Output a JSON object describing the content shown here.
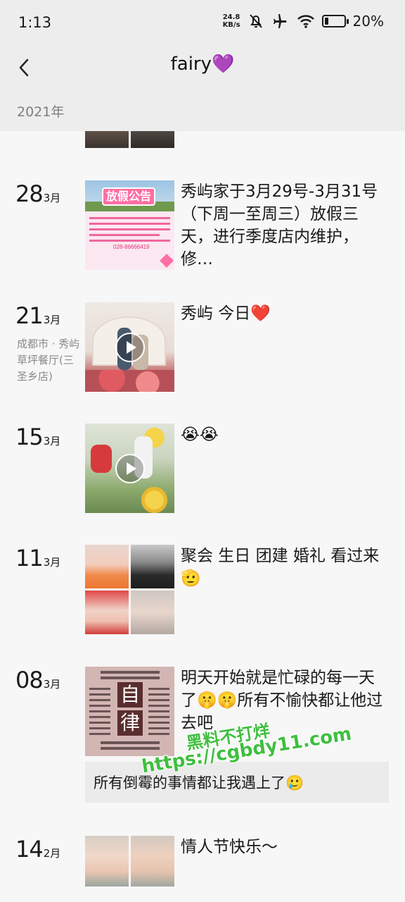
{
  "status_bar": {
    "time": "1:13",
    "net_speed_value": "24.8",
    "net_speed_unit": "KB/s",
    "battery_percent": "20%",
    "battery_level": 0.2
  },
  "nav": {
    "title": "fairy",
    "title_emoji": "💜"
  },
  "year": "2021年",
  "entries": [
    {
      "day": "28",
      "month": "3月",
      "text": "秀屿家于3月29号-3月31号（下周一至周三）放假三天，进行季度店内维护，修…",
      "poster_title": "放假公告",
      "poster_phone": "028-86666419"
    },
    {
      "day": "21",
      "month": "3月",
      "location": "成都市 · 秀屿草坪餐厅(三圣乡店)",
      "text": "秀屿 今日",
      "emoji": "❤️"
    },
    {
      "day": "15",
      "month": "3月",
      "text": "",
      "emoji": "😭😭"
    },
    {
      "day": "11",
      "month": "3月",
      "text": "聚会 生日 团建 婚礼 看过来",
      "emoji": "🫡"
    },
    {
      "day": "08",
      "month": "3月",
      "text_a": "明天开始就是忙碌的每一天了",
      "text_b": "所有不愉快都让他过去吧",
      "poster_char_1": "自",
      "poster_char_2": "律",
      "quote": "所有倒霉的事情都让我遇上了"
    },
    {
      "day": "14",
      "month": "2月",
      "text": "情人节快乐～"
    }
  ],
  "watermark": {
    "line1": "黑料不打烊",
    "line2": "https://cgbdy11.com"
  },
  "colors": {
    "header_bg": "#ededed",
    "feed_bg": "#f7f7f7",
    "secondary_text": "#8a8a8a",
    "watermark_green": "#3fbf3f",
    "accent_pink": "#e8307a"
  }
}
